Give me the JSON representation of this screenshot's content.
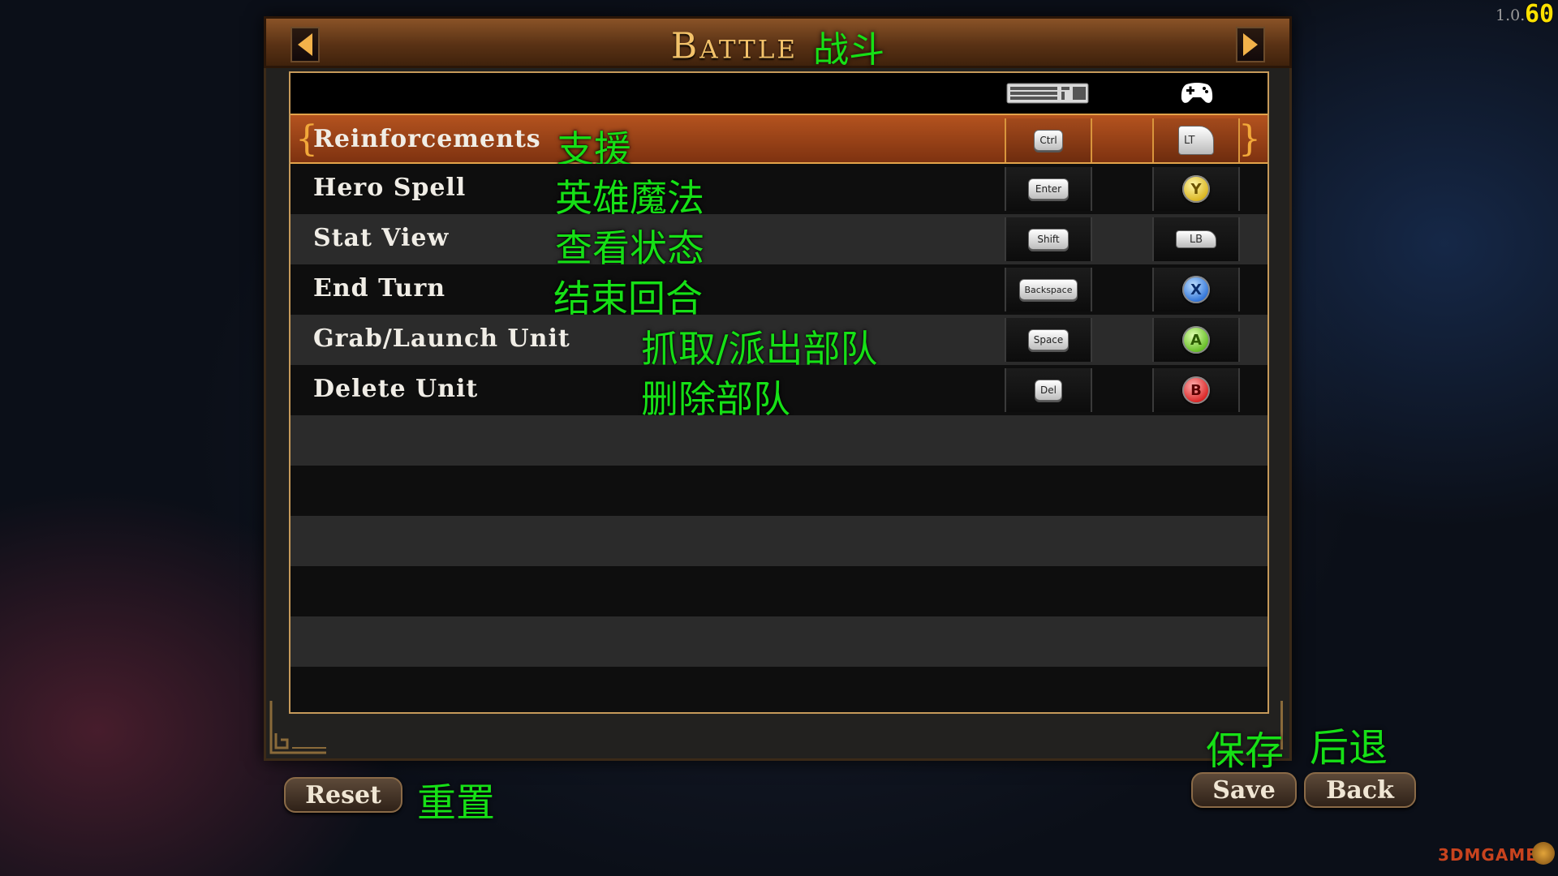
{
  "overlay": {
    "version": "1.0.",
    "fps": "60"
  },
  "header": {
    "title": "Battle",
    "title_cn": "战斗",
    "prev_icon": "chevron-left-icon",
    "next_icon": "chevron-right-icon"
  },
  "columns": {
    "keyboard_icon": "keyboard-icon",
    "gamepad_icon": "gamepad-icon"
  },
  "rows": [
    {
      "label": "Reinforcements",
      "cn": "支援",
      "key": "Ctrl",
      "pad": "LT",
      "pad_type": "trigger",
      "selected": true
    },
    {
      "label": "Hero Spell",
      "cn": "英雄魔法",
      "key": "Enter",
      "pad": "Y",
      "pad_type": "y"
    },
    {
      "label": "Stat View",
      "cn": "查看状态",
      "key": "Shift",
      "pad": "LB",
      "pad_type": "bumper"
    },
    {
      "label": "End Turn",
      "cn": "结束回合",
      "key": "Backspace",
      "pad": "X",
      "pad_type": "x"
    },
    {
      "label": "Grab/Launch Unit",
      "cn": "抓取/派出部队",
      "key": "Space",
      "pad": "A",
      "pad_type": "a"
    },
    {
      "label": "Delete Unit",
      "cn": "删除部队",
      "key": "Del",
      "pad": "B",
      "pad_type": "b"
    }
  ],
  "footer": {
    "reset_label": "Reset",
    "reset_cn": "重置",
    "save_label": "Save",
    "save_cn": "保存",
    "back_label": "Back",
    "back_cn": "后退"
  },
  "watermark": "3DMGAME"
}
